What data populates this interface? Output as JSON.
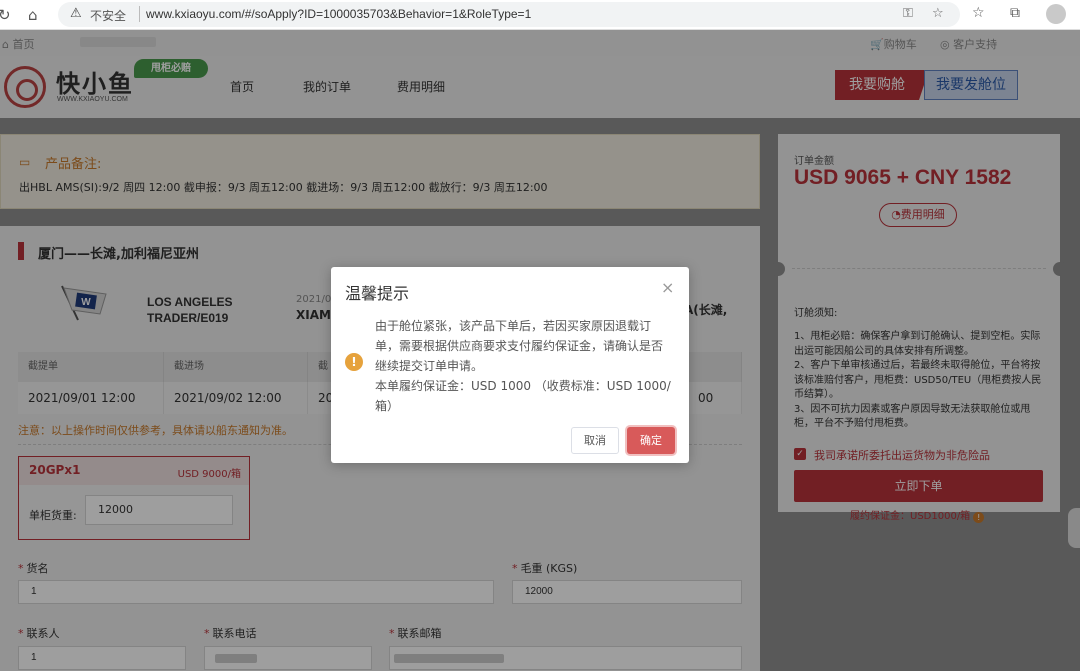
{
  "browser": {
    "security_label": "不安全",
    "url": "www.kxiaoyu.com/#/soApply?ID=1000035703&Behavior=1&RoleType=1"
  },
  "topstrip": {
    "home": "首页",
    "cart": "购物车",
    "support": "客户支持"
  },
  "header": {
    "logo_text": "快小鱼",
    "logo_sub": "WWW.KXIAOYU.COM",
    "logo_badge": "甩柜必赔",
    "nav": [
      "首页",
      "我的订单",
      "费用明细"
    ],
    "buy_button": "我要购舱",
    "post_button": "我要发舱位"
  },
  "notice": {
    "title": "产品备注:",
    "body": "出HBL AMS(SI):9/2 周四 12:00 截申报：9/3 周五12:00 截进场：9/3 周五12:00 截放行：9/3 周五12:00"
  },
  "route": {
    "title": "厦门——长滩,加利福尼亚州",
    "vessel_line1": "LOS ANGELES",
    "vessel_line2": "TRADER/E019",
    "etd_partial": "2021/0",
    "pol_partial": "XIAM",
    "pod_partial": "A(长滩,"
  },
  "table": {
    "headers": [
      "截提单",
      "截进场",
      "截"
    ],
    "cells": [
      "2021/09/01 12:00",
      "2021/09/02 12:00",
      "20",
      "00"
    ]
  },
  "note": "注意：以上操作时间仅供参考，具体请以船东通知为准。",
  "container": {
    "type": "20GPx1",
    "price": "USD 9000/箱",
    "weight_label": "单柜货重:",
    "weight_value": "12000"
  },
  "form": {
    "cargo_label": "货名",
    "cargo_value": "1",
    "gross_label": "毛重 (KGS)",
    "gross_value": "12000",
    "contact_label": "联系人",
    "contact_value": "1",
    "phone_label": "联系电话",
    "email_label": "联系邮箱"
  },
  "order": {
    "amount_label": "订单金额",
    "total": "USD 9065 + CNY 1582",
    "fee_detail": "费用明细",
    "notes_title": "订舱须知:",
    "notes": [
      "1、甩柜必赔：确保客户拿到订舱确认、提到空柜。实际出运可能因船公司的具体安排有所调整。",
      "2、客户下单审核通过后，若最终未取得舱位，平台将按该标准赔付客户，甩柜费：USD50/TEU（甩柜费按人民币结算）。",
      "3、因不可抗力因素或客户原因导致无法获取舱位或甩柜，平台不予赔付甩柜费。"
    ],
    "check_label": "我司承诺所委托出运货物为非危险品",
    "submit": "立即下单",
    "deposit": "履约保证金：USD1000/箱"
  },
  "dialog": {
    "title": "温馨提示",
    "message": "由于舱位紧张，该产品下单后，若因买家原因退载订单，需要根据供应商要求支付履约保证金，请确认是否继续提交订单申请。",
    "deposit_line": "本单履约保证金：USD 1000 （收费标准：USD 1000/箱）",
    "cancel": "取消",
    "confirm": "确定"
  },
  "colors": {
    "brand_red": "#b8323a",
    "warning_orange": "#e6a23c",
    "confirm_button": "#d85a5a"
  }
}
